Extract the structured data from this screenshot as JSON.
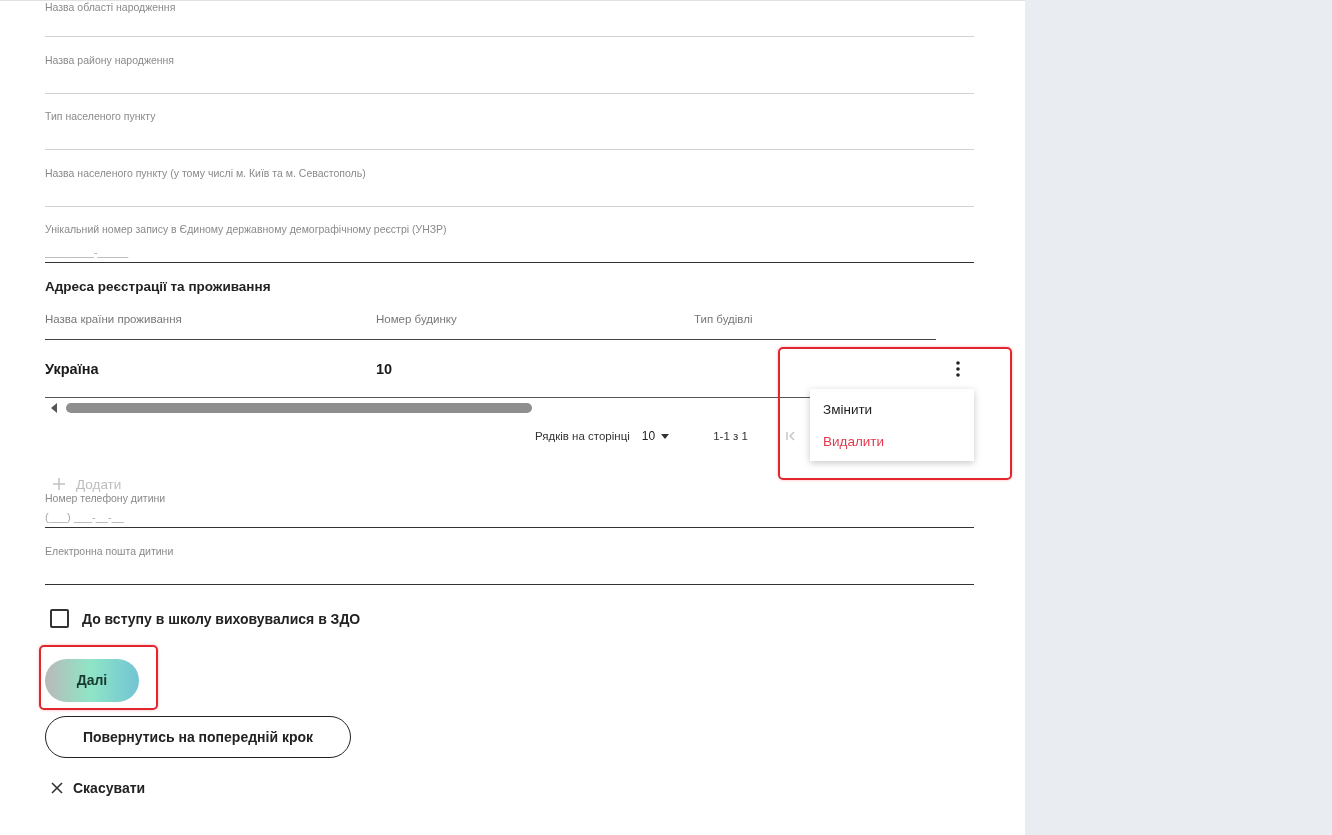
{
  "birth_fields": [
    {
      "label": "Назва області народження",
      "disabled": true
    },
    {
      "label": "Назва району народження",
      "disabled": true
    },
    {
      "label": "Тип населеного пункту",
      "disabled": true
    },
    {
      "label": "Назва населеного пункту (у тому числі м. Київ та м. Севастополь)",
      "disabled": true
    },
    {
      "label": "Унікальний номер запису в Єдиному державному демографічному реєстрі (УНЗР)",
      "placeholder": "________-_____",
      "disabled": false
    }
  ],
  "address": {
    "title": "Адреса реєстрації та проживання",
    "table": {
      "columns": [
        "Назва країни проживання",
        "Номер будинку",
        "Тип будівлі"
      ],
      "rows": [
        {
          "cells": [
            "Україна",
            "10"
          ]
        }
      ]
    },
    "row_menu": {
      "open": true,
      "highlighted": true,
      "items": [
        {
          "label": "Змінити",
          "kind": "normal"
        },
        {
          "label": "Видалити",
          "kind": "danger"
        }
      ]
    },
    "pagination": {
      "rows_per_page_label": "Рядків на сторінці",
      "rows_per_page": "10",
      "range": "1-1 з 1"
    },
    "add_button": {
      "label": "Додати",
      "disabled": true
    }
  },
  "contact_fields": [
    {
      "label": "Номер телефону дитини",
      "placeholder": "(___) ___-__-__",
      "disabled": false
    },
    {
      "label": "Електронна пошта дитини",
      "disabled": false
    }
  ],
  "kindergarten_checkbox": {
    "label": "До вступу в школу виховувалися в ЗДО",
    "checked": false
  },
  "actions": [
    {
      "label": "Далі",
      "kind": "primary",
      "highlighted": true
    },
    {
      "label": "Повернутись на попередній крок",
      "kind": "outline",
      "highlighted": false
    },
    {
      "label": "Скасувати",
      "kind": "text",
      "highlighted": false
    }
  ]
}
